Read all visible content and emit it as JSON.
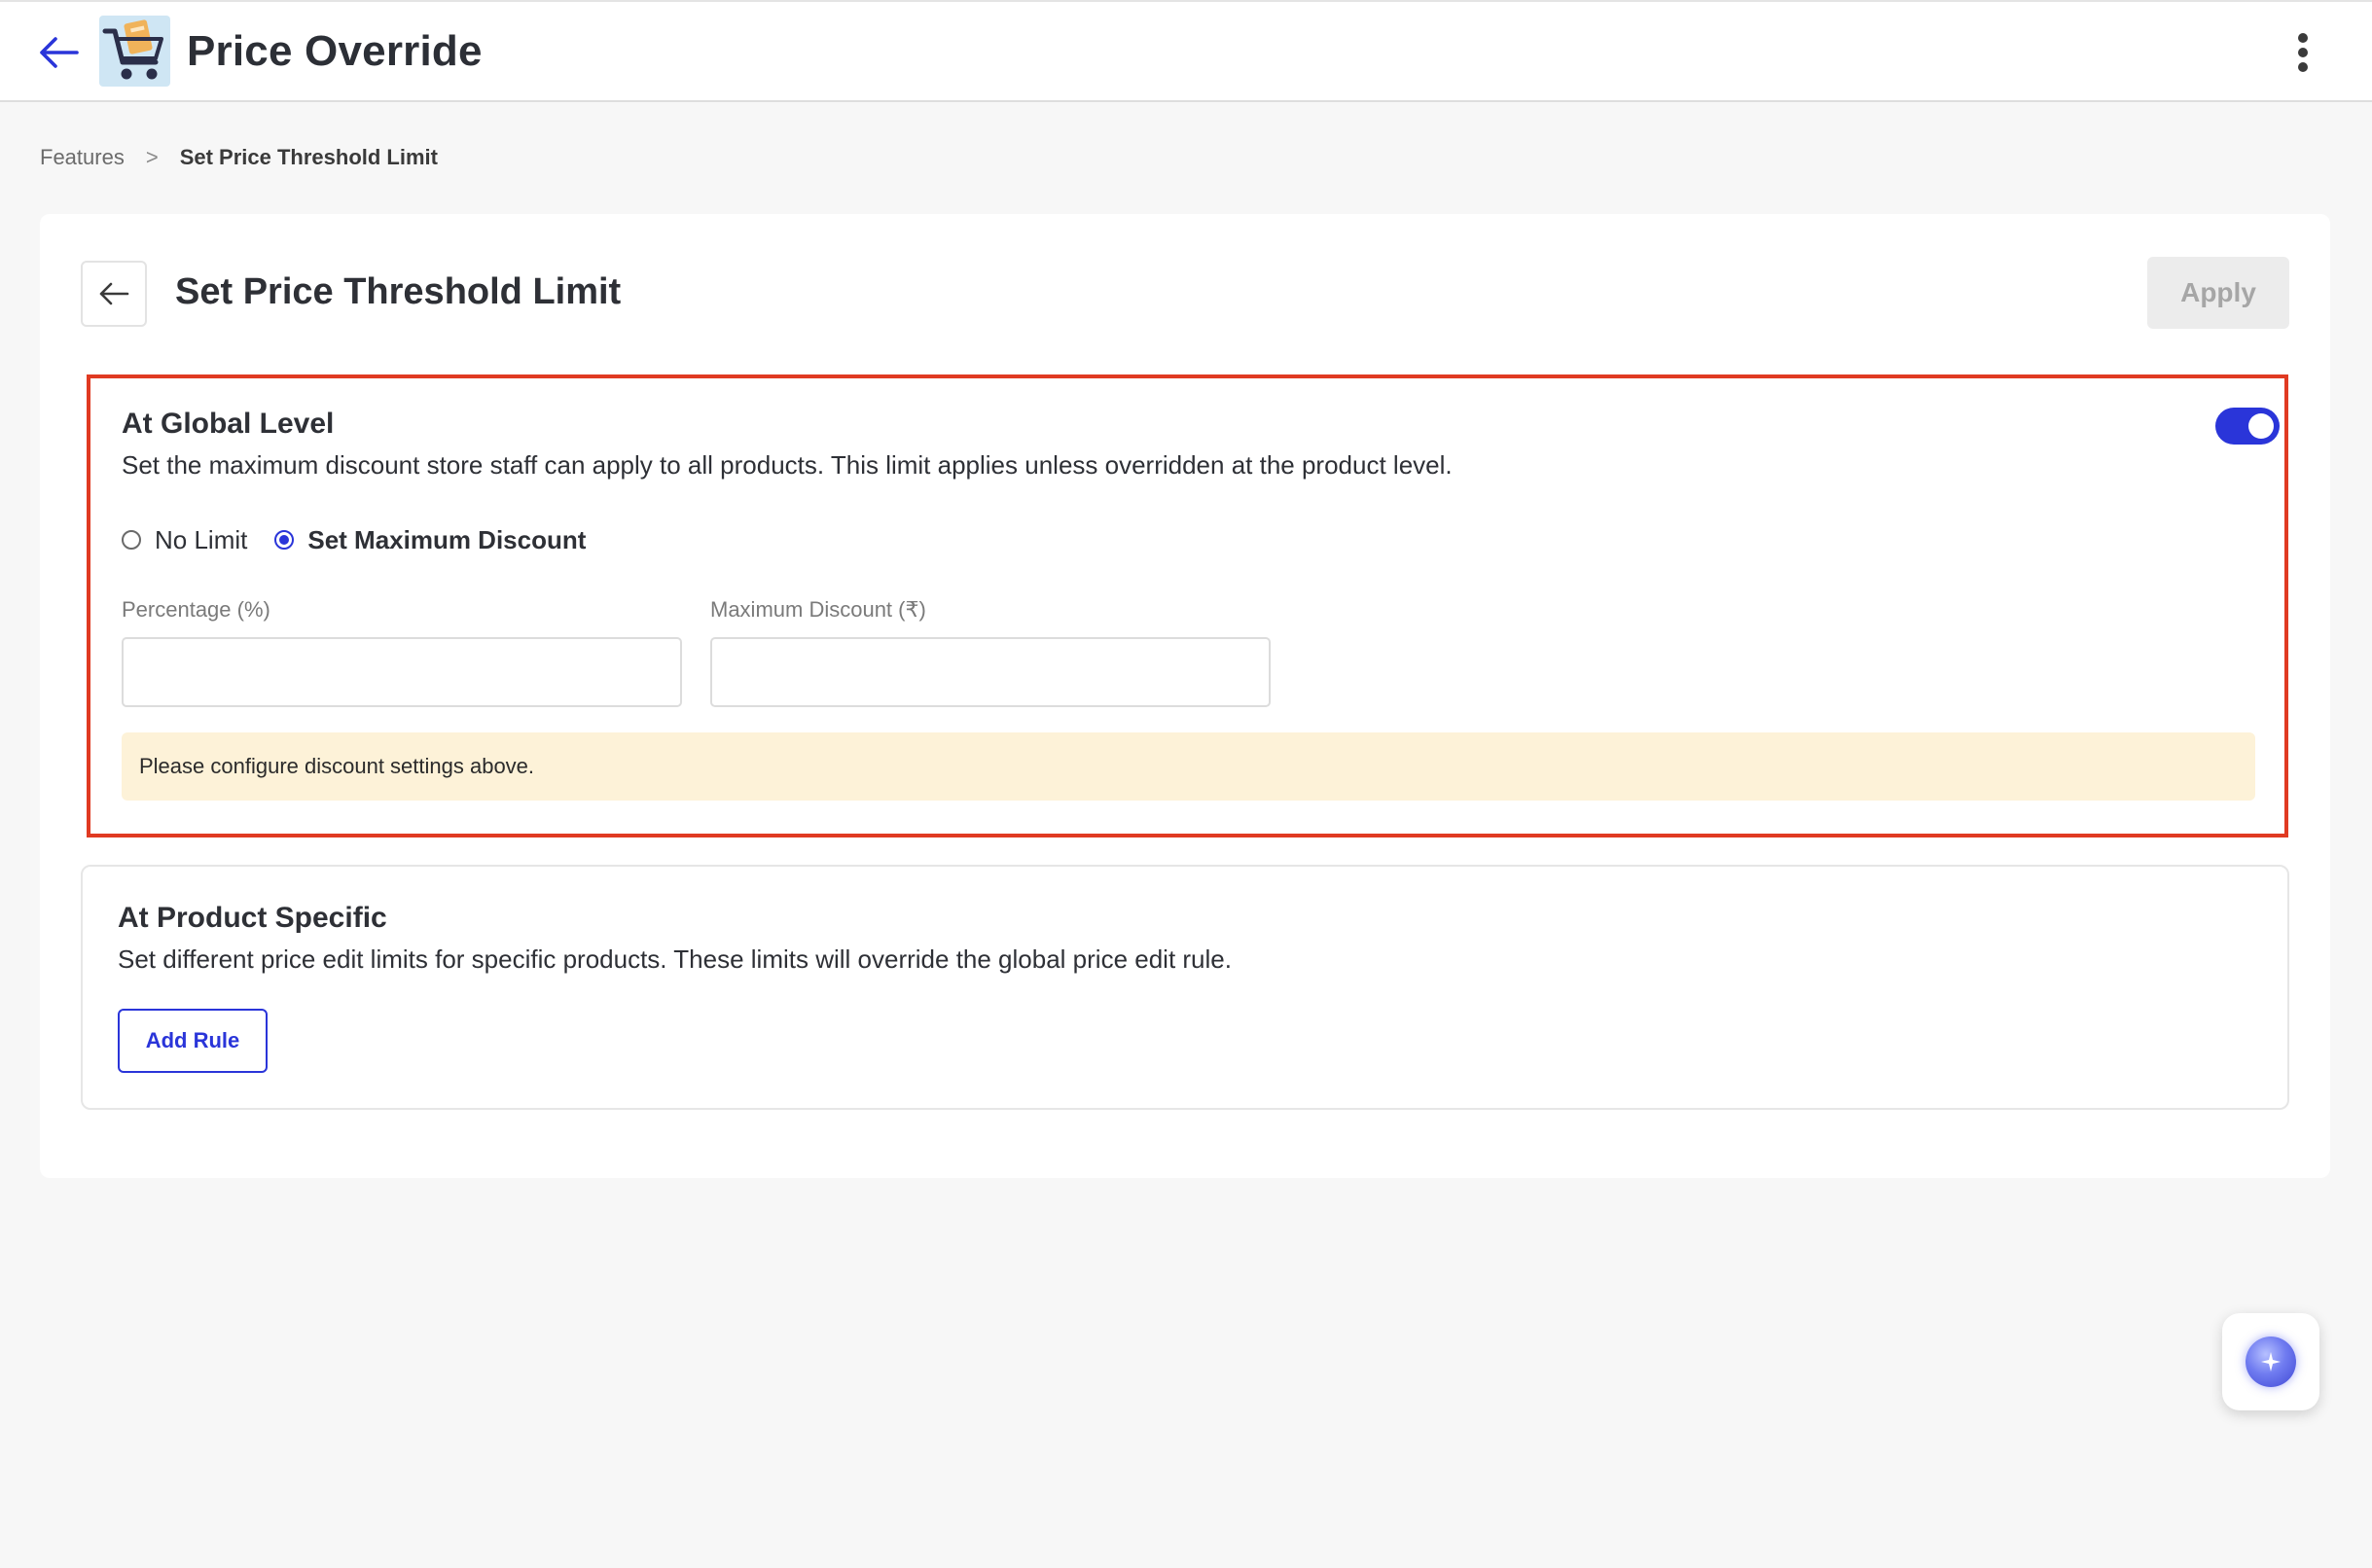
{
  "header": {
    "title": "Price Override",
    "back_icon": "arrow-left-icon",
    "logo_icon": "shopping-cart-logo-icon",
    "menu_icon": "kebab-menu-icon"
  },
  "breadcrumb": {
    "items": [
      "Features",
      "Set Price Threshold Limit"
    ],
    "separator": ">"
  },
  "page": {
    "title": "Set Price Threshold Limit",
    "back_icon": "arrow-left-icon",
    "apply_label": "Apply"
  },
  "global": {
    "title": "At Global Level",
    "description": "Set the maximum discount store staff can apply to all products. This limit applies unless overridden at the product level.",
    "enabled": true,
    "radio_options": [
      "No Limit",
      "Set Maximum Discount"
    ],
    "selected_option": "Set Maximum Discount",
    "percentage_label": "Percentage (%)",
    "percentage_value": "",
    "max_discount_label": "Maximum Discount (₹)",
    "max_discount_value": "",
    "notice": "Please configure discount settings above."
  },
  "product": {
    "title": "At Product Specific",
    "description": "Set different price edit limits for specific products. These limits will override the global price edit rule.",
    "add_rule_label": "Add Rule"
  },
  "colors": {
    "accent": "#2a35d9",
    "highlight_border": "#e03a22",
    "notice_bg": "#fdf2d8",
    "page_bg": "#f7f7f7"
  },
  "fab": {
    "icon": "ai-assistant-sparkle-icon"
  }
}
